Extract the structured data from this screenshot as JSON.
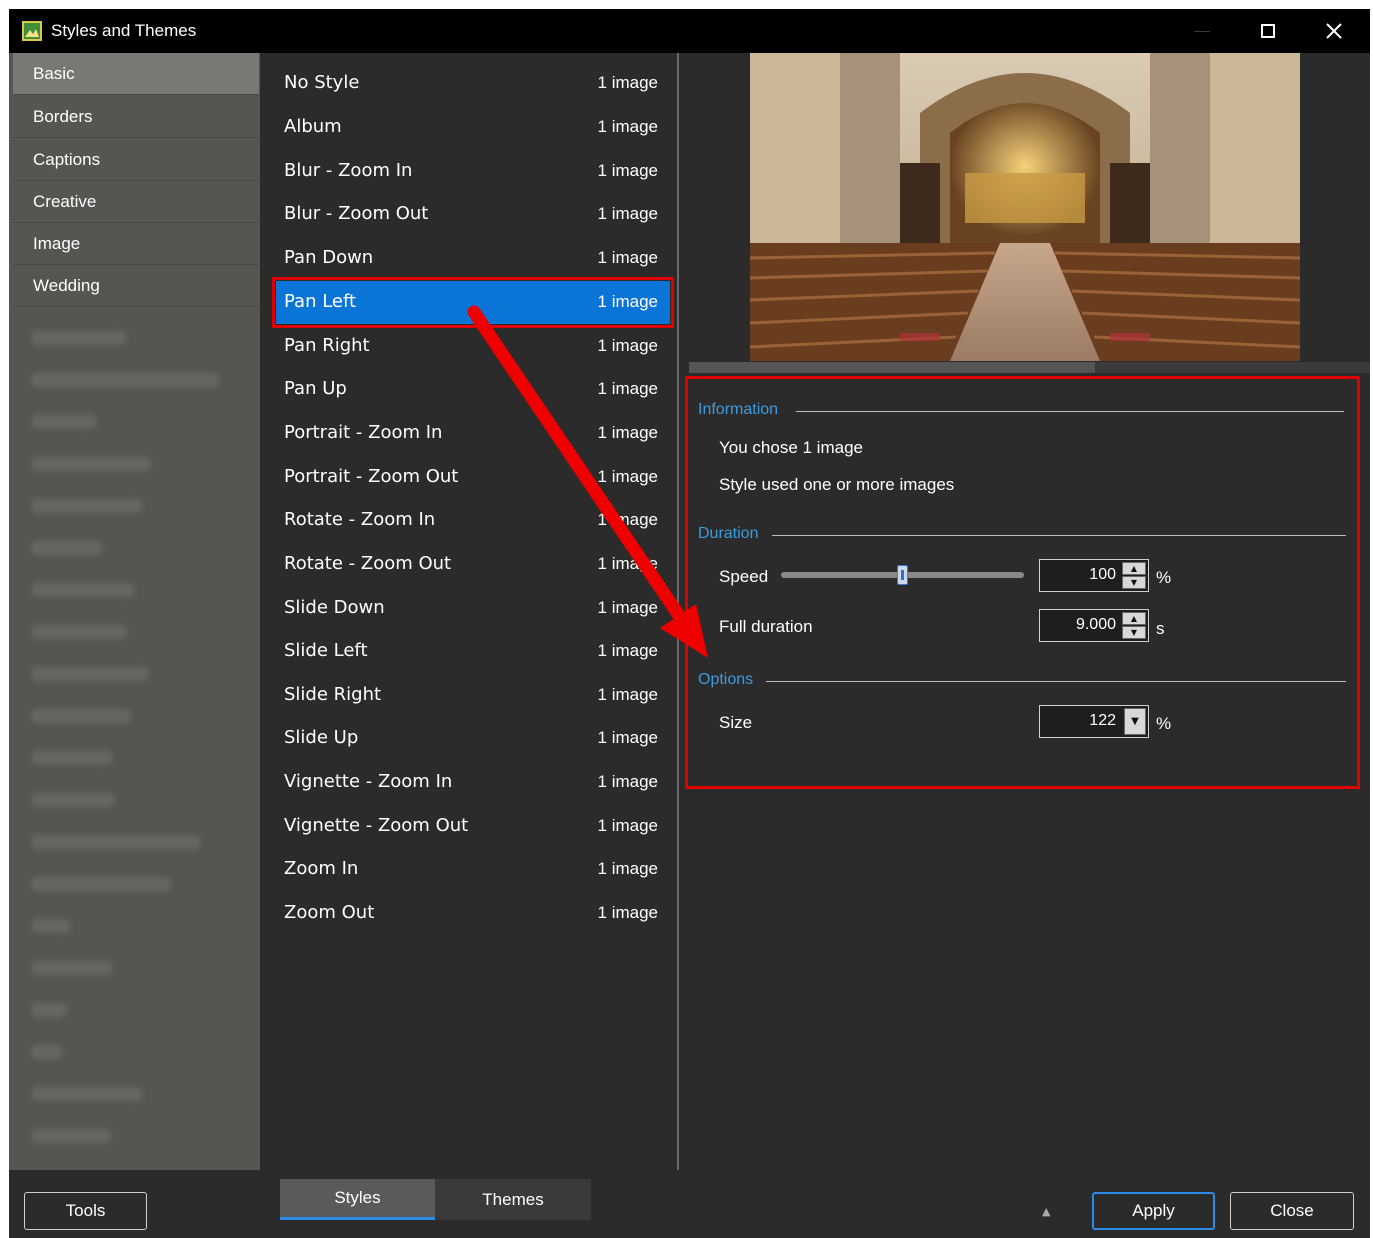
{
  "window": {
    "title": "Styles and Themes",
    "accent_color": "#0a75d6",
    "highlight_color": "#e00000"
  },
  "categories": [
    {
      "label": "Basic",
      "active": true
    },
    {
      "label": "Borders",
      "active": false
    },
    {
      "label": "Captions",
      "active": false
    },
    {
      "label": "Creative",
      "active": false
    },
    {
      "label": "Image",
      "active": false
    },
    {
      "label": "Wedding",
      "active": false
    }
  ],
  "styles": [
    {
      "name": "No Style",
      "count": "1 image"
    },
    {
      "name": "Album",
      "count": "1 image"
    },
    {
      "name": "Blur - Zoom In",
      "count": "1 image"
    },
    {
      "name": "Blur - Zoom Out",
      "count": "1 image"
    },
    {
      "name": "Pan Down",
      "count": "1 image"
    },
    {
      "name": "Pan Left",
      "count": "1 image",
      "selected": true
    },
    {
      "name": "Pan Right",
      "count": "1 image"
    },
    {
      "name": "Pan Up",
      "count": "1 image"
    },
    {
      "name": "Portrait - Zoom In",
      "count": "1 image"
    },
    {
      "name": "Portrait - Zoom Out",
      "count": "1 image"
    },
    {
      "name": "Rotate - Zoom In",
      "count": "1 image"
    },
    {
      "name": "Rotate - Zoom Out",
      "count": "1 image"
    },
    {
      "name": "Slide Down",
      "count": "1 image"
    },
    {
      "name": "Slide Left",
      "count": "1 image"
    },
    {
      "name": "Slide Right",
      "count": "1 image"
    },
    {
      "name": "Slide Up",
      "count": "1 image"
    },
    {
      "name": "Vignette - Zoom In",
      "count": "1 image"
    },
    {
      "name": "Vignette - Zoom Out",
      "count": "1 image"
    },
    {
      "name": "Zoom In",
      "count": "1 image"
    },
    {
      "name": "Zoom Out",
      "count": "1 image"
    }
  ],
  "info": {
    "information_header": "Information",
    "chose_text": "You chose 1 image",
    "used_text": "Style used one or more images",
    "duration_header": "Duration",
    "speed_label": "Speed",
    "speed_value": "100",
    "speed_unit": "%",
    "speed_slider_fraction": 0.5,
    "full_duration_label": "Full duration",
    "full_duration_value": "9.000",
    "full_duration_unit": "s",
    "options_header": "Options",
    "size_label": "Size",
    "size_value": "122",
    "size_unit": "%"
  },
  "bottom": {
    "tools_label": "Tools",
    "tab_styles": "Styles",
    "tab_themes": "Themes",
    "apply_label": "Apply",
    "close_label": "Close"
  }
}
